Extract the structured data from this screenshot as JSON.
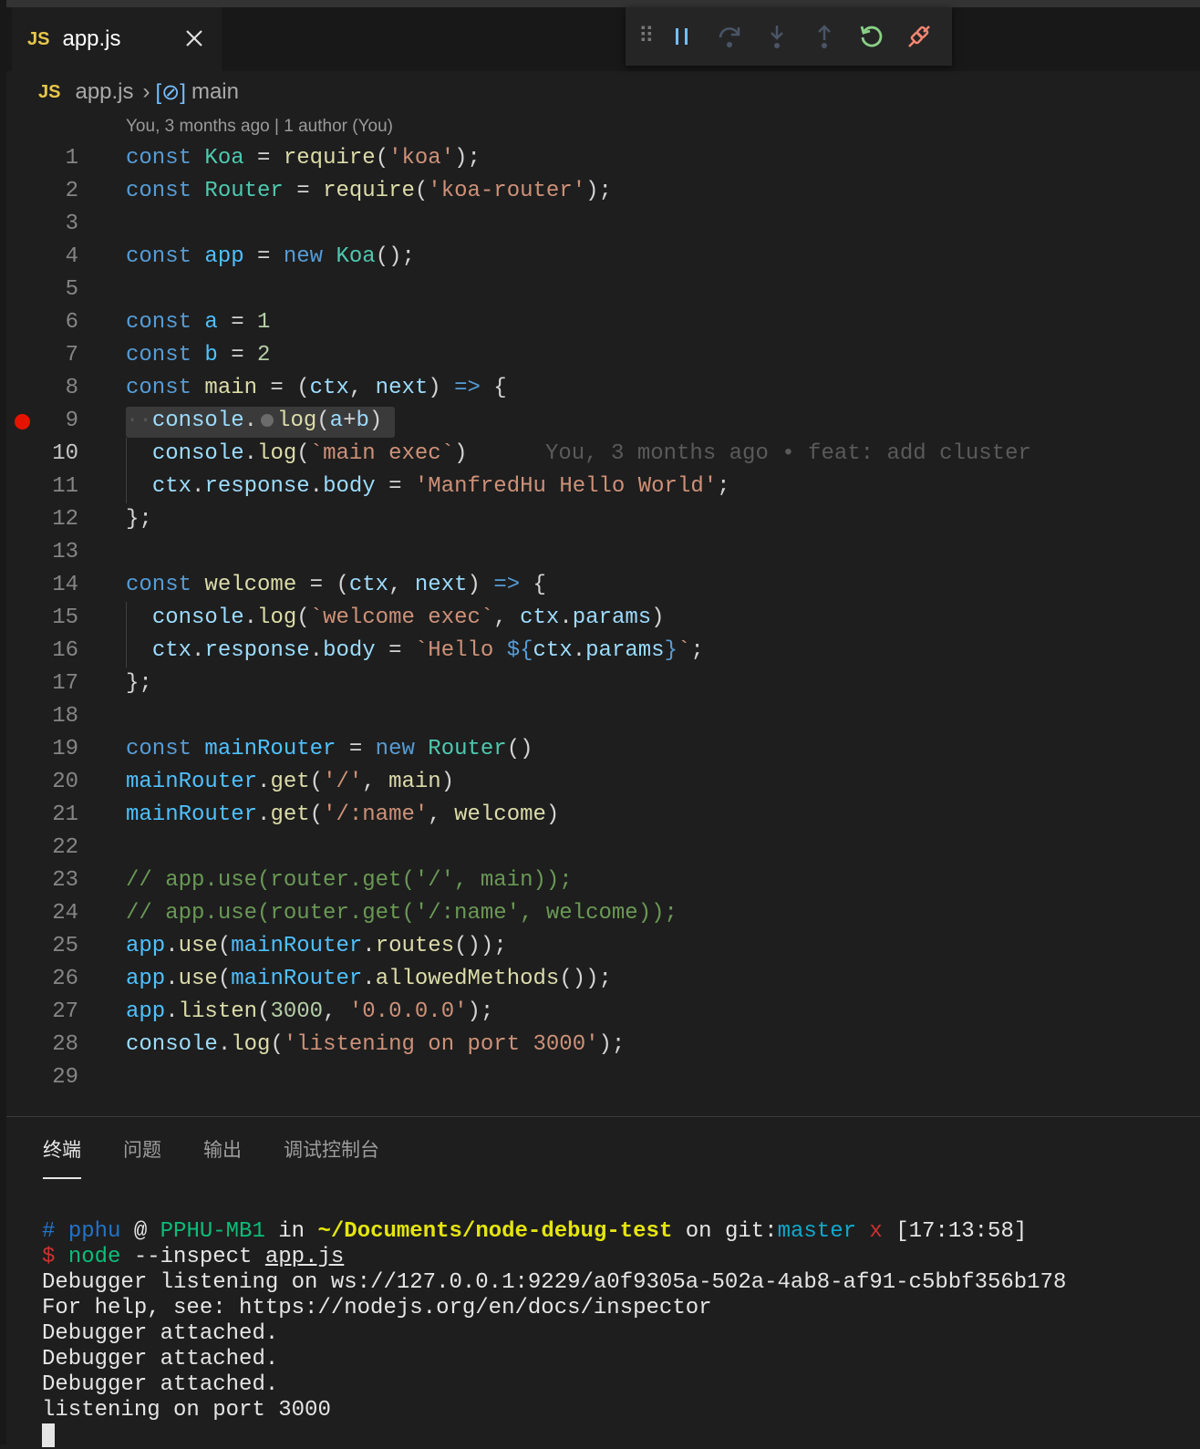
{
  "tab": {
    "lang": "JS",
    "name": "app.js"
  },
  "debug_toolbar": {
    "buttons": [
      "pause-icon",
      "step-over-icon",
      "step-into-icon",
      "step-out-icon",
      "restart-icon",
      "disconnect-icon"
    ]
  },
  "breadcrumb": {
    "lang": "JS",
    "file": "app.js",
    "symbol": "main"
  },
  "blame_header": "You, 3 months ago | 1 author (You)",
  "inline_blame": "You, 3 months ago • feat: add cluster",
  "line_numbers": [
    "1",
    "2",
    "3",
    "4",
    "5",
    "6",
    "7",
    "8",
    "9",
    "10",
    "11",
    "12",
    "13",
    "14",
    "15",
    "16",
    "17",
    "18",
    "19",
    "20",
    "21",
    "22",
    "23",
    "24",
    "25",
    "26",
    "27",
    "28",
    "29"
  ],
  "panel": {
    "tabs": [
      "终端",
      "问题",
      "输出",
      "调试控制台"
    ],
    "active_tab": "终端"
  },
  "terminal": {
    "prompt_hash": "#",
    "user": "pphu",
    "at": "@",
    "host": "PPHU-MB1",
    "in": "in",
    "path": "~/Documents/node-debug-test",
    "on_git": "on git:",
    "branch": "master",
    "dirty": "x",
    "time": "[17:13:58]",
    "dollar": "$",
    "cmd": "node",
    "args": "--inspect",
    "file": "app.js",
    "output": [
      "Debugger listening on ws://127.0.0.1:9229/a0f9305a-502a-4ab8-af91-c5bbf356b178",
      "For help, see: https://nodejs.org/en/docs/inspector",
      "Debugger attached.",
      "Debugger attached.",
      "Debugger attached.",
      "listening on port 3000"
    ]
  }
}
